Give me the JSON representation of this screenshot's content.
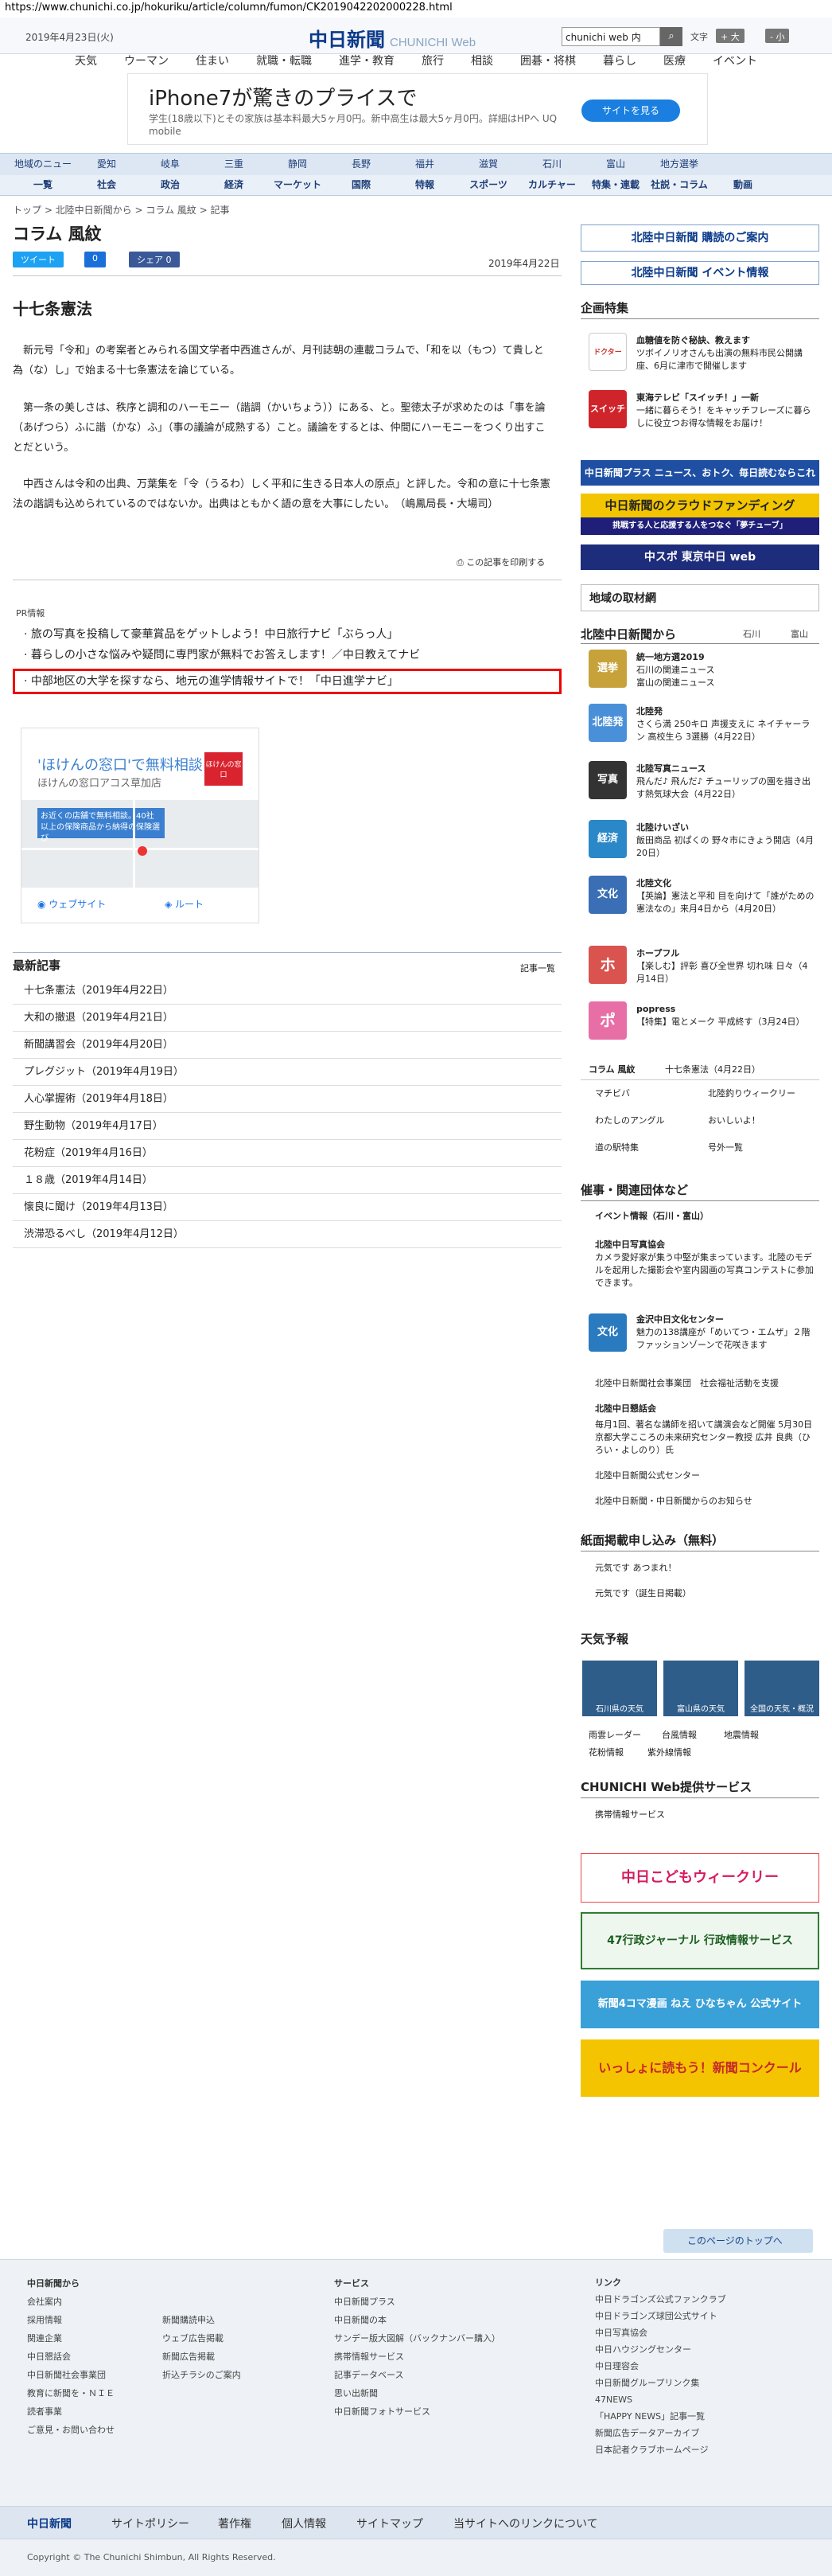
{
  "url": "https://www.chunichi.co.jp/hokuriku/article/column/fumon/CK2019042202000228.html",
  "header": {
    "date": "2019年4月23日(火)",
    "logo": "中日新聞",
    "logo_sub": "CHUNICHI Web",
    "search_value": "chunichi web 内",
    "search_icon": "magnifier",
    "font_size_label": "文字",
    "font_buttons": [
      "+ 大",
      "- 小"
    ]
  },
  "nav_top": [
    "天気",
    "ウーマン",
    "住まい",
    "就職・転職",
    "進学・教育",
    "旅行",
    "相談",
    "囲碁・将棋",
    "暮らし",
    "医療",
    "イベント"
  ],
  "ad_top": {
    "title": "iPhone7が驚きのプライスで",
    "sub": "学生(18歳以下)とその家族は基本料最大5ヶ月0円。新中高生は最大5ヶ月0円。詳細はHPへ UQ mobile",
    "button": "サイトを見る"
  },
  "nav_region": [
    "地域のニュース",
    "愛知",
    "岐阜",
    "三重",
    "静岡",
    "長野",
    "福井",
    "滋賀",
    "石川",
    "富山",
    "地方選挙"
  ],
  "nav_genre": [
    "一覧",
    "社会",
    "政治",
    "経済",
    "マーケット",
    "国際",
    "特報",
    "スポーツ",
    "カルチャー",
    "特集・連載",
    "社説・コラム",
    "動画"
  ],
  "breadcrumb": "トップ > 北陸中日新聞から > コラム 風紋 > 記事",
  "column_title": "コラム 風紋",
  "share": [
    "ツイート",
    "0",
    "シェア 0"
  ],
  "article_date": "2019年4月22日",
  "article": {
    "title": "十七条憲法",
    "paragraphs": [
      "新元号「令和」の考案者とみられる国文学者中西進さんが、月刊誌朝の連載コラムで、「和を以（もつ）て貴しと為（な）し」で始まる十七条憲法を論じている。",
      "第一条の美しさは、秩序と調和のハーモニー（諧調（かいちょう））にある、と。聖徳太子が求めたのは「事を論（あげつら）ふに諧（かな）ふ」（事の議論が成熟する）こと。議論をするとは、仲間にハーモニーをつくり出すことだという。",
      "中西さんは令和の出典、万葉集を「令（うるわ）しく平和に生きる日本人の原点」と評した。令和の意に十七条憲法の諧調も込められているのではないか。出典はともかく語の意を大事にしたい。　（嶋鳳局長・大場司）"
    ],
    "print_link": "この記事を印刷する"
  },
  "pr": {
    "label": "PR情報",
    "lines": [
      "旅の写真を投稿して豪華賞品をゲットしよう！中日旅行ナビ「ぶらっ人」",
      "暮らしの小さな悩みや疑問に専門家が無料でお答えします！／中日教えてナビ",
      "中部地区の大学を探すなら、地元の進学情報サイトで！「中日進学ナビ」"
    ]
  },
  "map_ad": {
    "title": "'ほけんの窓口'で無料相談",
    "sub": "ほけんの窓口アコス草加店",
    "badge": "ほけんの窓口",
    "desc": "お近くの店舗で無料相談。40社以上の保険商品から納得の保険選び",
    "website": "ウェブサイト",
    "route": "ルート"
  },
  "latest": {
    "title": "最新記事",
    "more": "記事一覧",
    "items": [
      "十七条憲法（2019年4月22日）",
      "大和の撤退（2019年4月21日）",
      "新聞講習会（2019年4月20日）",
      "プレグジット（2019年4月19日）",
      "人心掌握術（2019年4月18日）",
      "野生動物（2019年4月17日）",
      "花粉症（2019年4月16日）",
      "１８歳（2019年4月14日）",
      "懐良に聞け（2019年4月13日）",
      "渋滞恐るべし（2019年4月12日）"
    ]
  },
  "sidebar": {
    "subscribe": "北陸中日新聞 購読のご案内",
    "event": "北陸中日新聞 イベント情報",
    "feature_title": "企画特集",
    "features": [
      {
        "title": "血糖値を防ぐ秘訣、教えます",
        "text": "ツボイノリオさんも出演の無料市民公開講座、6月に津市で開催します",
        "icon": "ドクター"
      },
      {
        "title": "東海テレビ「スイッチ！」一新",
        "text": "一緒に暮らそう！をキャッチフレーズに暮らしに役立つお得な情報をお届け！",
        "icon": "スイッチ"
      }
    ],
    "banners": [
      "中日新聞プラス ニュース、おトク、毎日読むならこれ",
      "中日新聞のクラウドファンディング",
      "挑戦する人と応援する人をつなぐ「夢チューブ」",
      "中スポ 東京中日 web"
    ],
    "local_title": "地域の取材網",
    "from_title": "北陸中日新聞から",
    "from_tabs": [
      "石川",
      "富山"
    ],
    "from_items": [
      {
        "title": "統一地方選2019",
        "text": "石川の関連ニュース\n富山の関連ニュース",
        "icon": "選挙"
      },
      {
        "title": "北陸発",
        "text": "さくら満 250キロ 声援支えに ネイチャーラン 高校生ら 3選勝（4月22日）",
        "icon": "北陸発"
      },
      {
        "title": "北陸写真ニュース",
        "text": "飛んだ♪ 飛んだ♪ チューリップの園を描き出す熱気球大会（4月22日）",
        "icon": "写真"
      },
      {
        "title": "北陸けいざい",
        "text": "飯田商品 初ぱくの 野々市にきょう開店（4月20日）",
        "icon": "経済"
      },
      {
        "title": "北陸文化",
        "text": "【英論】憲法と平和 目を向けて「誰がための憲法なの」来月4日から（4月20日）",
        "icon": "文化"
      },
      {
        "title": "ホープフル",
        "text": "【楽しむ】評彰 喜び全世界 切れ味 日々（4月14日）",
        "icon": "ホ"
      },
      {
        "title": "popress",
        "text": "【特集】電とメーク 平成終す（3月24日）",
        "icon": "ポ"
      }
    ],
    "column_links": [
      "コラム 風紋",
      "十七条憲法（4月22日）"
    ],
    "links_grid": [
      "マチビバ",
      "北陸釣りウィークリー",
      "わたしのアングル",
      "おいしいよ！",
      "道の駅特集",
      "号外一覧"
    ],
    "sponsor_title": "催事・関連団体など",
    "sponsor_sub": "イベント情報（石川・富山）",
    "sponsor_items": [
      {
        "title": "北陸中日写真協会",
        "text": "カメラ愛好家が集う中堅が集まっています。北陸のモデルを起用した撮影会や室内図画の写真コンテストに参加できます。",
        "icon": "写"
      },
      {
        "title": "金沢中日文化センター",
        "text": "魅力の138講座が「めいてつ・エムザ」２階ファッションゾーンで花咲きます",
        "icon": "文化"
      }
    ],
    "sponsor_links": [
      "北陸中日新聞社会事業団　社会福祉活動を支援",
      "北陸中日懇話会",
      "北陸中日新聞公式センター",
      "北陸中日新聞・中日新聞からのお知らせ"
    ],
    "konwa_text": "毎月1回、著名な講師を招いて講演会など開催 5月30日 京都大学こころの未来研究センター教授 広井 良典（ひろい・よしのり）氏",
    "paper_title": "紙面掲載申し込み（無料）",
    "paper_links": [
      "元気です あつまれ！",
      "元気です（誕生日掲載）"
    ],
    "weather_title": "天気予報",
    "weather_tiles": [
      "石川県の天気",
      "富山県の天気",
      "全国の天気・概況"
    ],
    "weather_links": [
      "雨雲レーダー",
      "台風情報",
      "地震情報",
      "花粉情報",
      "紫外線情報"
    ],
    "service_title": "CHUNICHI Web提供サービス",
    "service_link": "携帯情報サービス",
    "ads": [
      "中日こどもウィークリー",
      "47行政ジャーナル 行政情報サービス",
      "新聞4コマ漫画 ねえ ひなちゃん 公式サイト",
      "いっしょに読もう！新聞コンクール"
    ]
  },
  "back_to_top": "このページのトップへ",
  "footer": {
    "col1_title": "中日新聞から",
    "col1": [
      "会社案内",
      "採用情報",
      "関連企業",
      "中日懇話会",
      "中日新聞社会事業団",
      "教育に新聞を・ＮＩＥ",
      "読者事業",
      "ご意見・お問い合わせ"
    ],
    "col2": [
      "新聞購読申込",
      "ウェブ広告掲載",
      "新聞広告掲載",
      "折込チラシのご案内"
    ],
    "col3_title": "サービス",
    "col3": [
      "中日新聞プラス",
      "中日新聞の本",
      "サンデー版大図解（バックナンバー購入）",
      "携帯情報サービス",
      "記事データベース",
      "思い出新聞",
      "中日新聞フォトサービス"
    ],
    "col4_title": "リンク",
    "col4": [
      "中日ドラゴンズ公式ファンクラブ",
      "中日ドラゴンズ球団公式サイト",
      "中日写真協会",
      "中日ハウジングセンター",
      "中日理容会",
      "中日新聞グループリンク集",
      "47NEWS",
      "「HAPPY NEWS」記事一覧",
      "新聞広告データアーカイブ",
      "日本記者クラブホームページ"
    ],
    "bar": [
      "中日新聞",
      "サイトポリシー",
      "著作権",
      "個人情報",
      "サイトマップ",
      "当サイトへのリンクについて"
    ],
    "copyright": "Copyright © The Chunichi Shimbun, All Rights Reserved."
  },
  "colors": {
    "brand": "#0b3a8a",
    "nav_bg": "#dde7f3",
    "highlight": "#ee0000"
  }
}
